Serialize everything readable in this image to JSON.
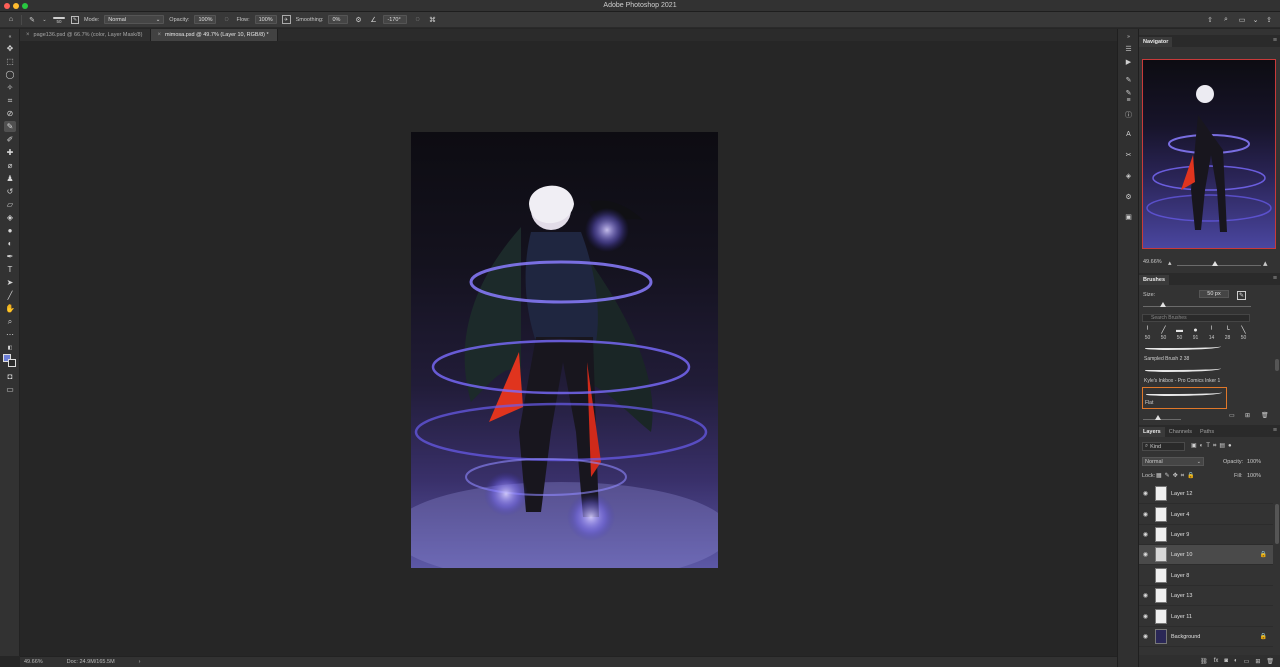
{
  "app": {
    "title": "Adobe Photoshop 2021"
  },
  "options_bar": {
    "brush_size": "50",
    "mode_label": "Mode:",
    "mode_value": "Normal",
    "opacity_label": "Opacity:",
    "opacity_value": "100%",
    "flow_label": "Flow:",
    "flow_value": "100%",
    "smoothing_label": "Smoothing:",
    "smoothing_value": "0%",
    "angle_value": "-170°"
  },
  "tabs": [
    {
      "label": "page136.psd @ 66.7% (color, Layer Mask/8)"
    },
    {
      "label": "mimosa.psd @ 49.7% (Layer 10, RGB/8) *"
    }
  ],
  "status": {
    "zoom": "49.66%",
    "doc": "Doc: 24.9M/165.5M"
  },
  "navigator": {
    "tab": "Navigator",
    "zoom": "49.66%"
  },
  "brushes": {
    "tab": "Brushes",
    "size_label": "Size:",
    "size_value": "50 px",
    "search_placeholder": "Search Brushes",
    "presets": [
      "50",
      "50",
      "50",
      "91",
      "14",
      "28",
      "50"
    ],
    "entries": [
      {
        "name": "Sampled Brush 2 38"
      },
      {
        "name": "Kyle's Inkbox - Pro Comics Inker 1"
      },
      {
        "name": "Flat"
      }
    ]
  },
  "layers_panel": {
    "tabs": [
      "Layers",
      "Channels",
      "Paths"
    ],
    "kind_label": "Kind",
    "blend_mode": "Normal",
    "opacity_label": "Opacity:",
    "opacity_value": "100%",
    "lock_label": "Lock:",
    "fill_label": "Fill:",
    "fill_value": "100%",
    "layers": [
      {
        "name": "Layer 12"
      },
      {
        "name": "Layer 4"
      },
      {
        "name": "Layer 9"
      },
      {
        "name": "Layer 10"
      },
      {
        "name": "Layer 8"
      },
      {
        "name": "Layer 13"
      },
      {
        "name": "Layer 11"
      },
      {
        "name": "Background"
      }
    ]
  },
  "colors": {
    "accent_orange": "#e0782a",
    "navigator_frame": "#c83a3a",
    "foreground_swatch": "#6d7fd6"
  }
}
